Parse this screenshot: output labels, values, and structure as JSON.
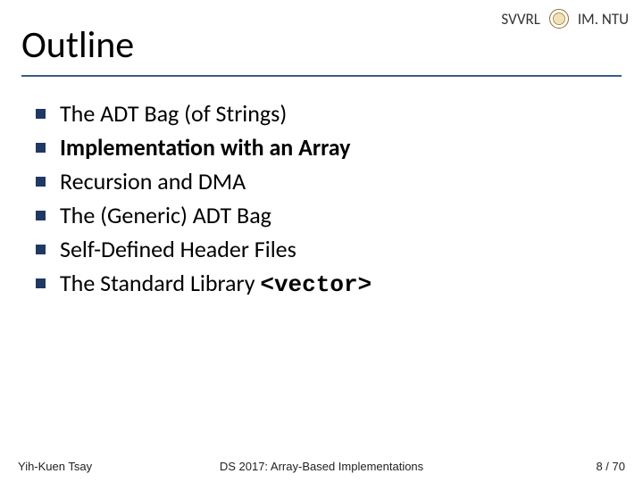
{
  "header": {
    "org_left": "SVVRL",
    "at": "@",
    "org_right": "IM. NTU"
  },
  "title": "Outline",
  "bullets": [
    {
      "text": "The ADT Bag (of Strings)",
      "bold": false
    },
    {
      "text": "Implementation with an Array",
      "bold": true
    },
    {
      "text": "Recursion and DMA",
      "bold": false
    },
    {
      "text": "The (Generic) ADT Bag",
      "bold": false
    },
    {
      "text": "Self-Defined Header Files",
      "bold": false
    },
    {
      "text_prefix": "The Standard Library ",
      "code": "<vector>",
      "bold": false
    }
  ],
  "footer": {
    "left": "Yih-Kuen Tsay",
    "center": "DS 2017: Array-Based Implementations",
    "right": "8 / 70"
  }
}
